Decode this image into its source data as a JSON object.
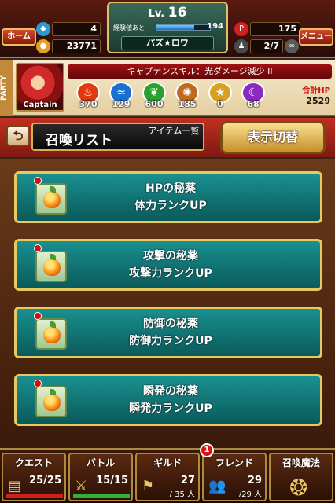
{
  "header": {
    "home_label": "ホーム",
    "menu_label": "メニュー",
    "gems": "4",
    "coins": "23771",
    "level_prefix": "Lv.",
    "level": "16",
    "exp_label": "経験値あと",
    "exp_remaining": "194",
    "exp_fill_ratio": 0.7,
    "player_name": "パズ★ロワ",
    "points": "175",
    "friend_slots": "2/7"
  },
  "party": {
    "tab_label": "PARTY",
    "captain_label": "Captain",
    "captain_skill": "キャプテンスキル：光ダメージ減少 II",
    "attributes": [
      {
        "name": "fire",
        "value": "370",
        "color": "#e03a10"
      },
      {
        "name": "water",
        "value": "129",
        "color": "#1a70d0"
      },
      {
        "name": "wind",
        "value": "600",
        "color": "#2aa030"
      },
      {
        "name": "earth",
        "value": "185",
        "color": "#c06a20"
      },
      {
        "name": "light",
        "value": "0",
        "color": "#d8a020"
      },
      {
        "name": "dark",
        "value": "68",
        "color": "#8a2ac0"
      }
    ],
    "total_hp_label": "合計HP",
    "total_hp": "2529"
  },
  "title_bar": {
    "back_glyph": "⮌",
    "title": "召喚リスト",
    "subtitle": "アイテム一覧",
    "toggle_label": "表示切替"
  },
  "items": [
    {
      "name": "HPの秘薬",
      "desc": "体力ランクUP"
    },
    {
      "name": "攻撃の秘薬",
      "desc": "攻撃力ランクUP"
    },
    {
      "name": "防御の秘薬",
      "desc": "防御力ランクUP"
    },
    {
      "name": "瞬発の秘薬",
      "desc": "瞬発力ランクUP"
    }
  ],
  "nav": {
    "quest": {
      "label": "クエスト",
      "count": "25/25"
    },
    "battle": {
      "label": "バトル",
      "count": "15/15"
    },
    "guild": {
      "label": "ギルド",
      "count": "27",
      "sub": "/ 35 人"
    },
    "friend": {
      "label": "フレンド",
      "count": "29",
      "sub": "/29 人",
      "badge": "1"
    },
    "summon": {
      "label": "召喚魔法"
    }
  }
}
